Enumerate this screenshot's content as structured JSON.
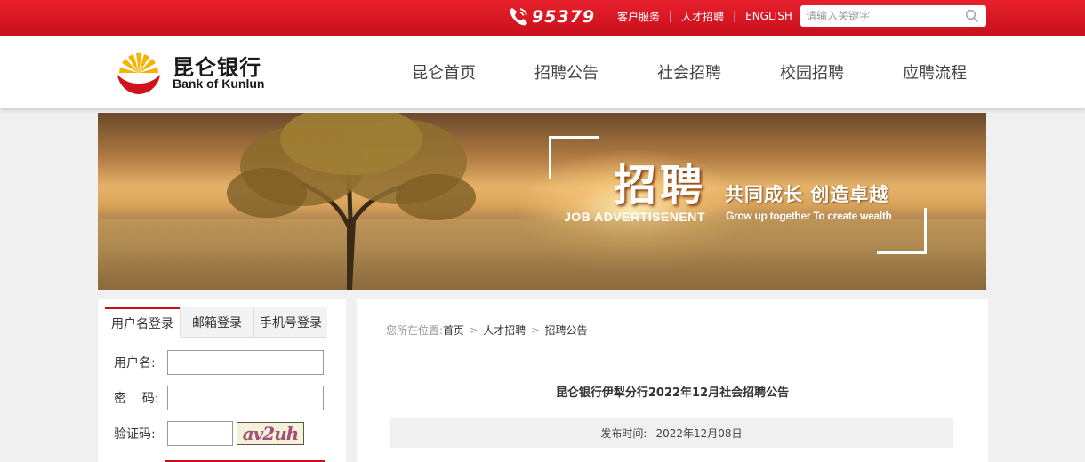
{
  "topbar": {
    "hotline": "95379",
    "links": [
      "客户服务",
      "人才招聘",
      "ENGLISH"
    ],
    "separator": "|",
    "search_placeholder": "请输入关键字",
    "bg_color": "#d8141f"
  },
  "header": {
    "logo_cn": "昆仑银行",
    "logo_en": "Bank of Kunlun",
    "nav": [
      "昆仑首页",
      "招聘公告",
      "社会招聘",
      "校园招聘",
      "应聘流程"
    ]
  },
  "banner": {
    "title": "招聘",
    "slogan": "共同成长  创造卓越",
    "en_title": "JOB   ADVERTISENENT",
    "en_slogan": "Grow up together To create wealth"
  },
  "login": {
    "tabs": [
      "用户名登录",
      "邮箱登录",
      "手机号登录"
    ],
    "active_tab": "用户名登录",
    "username_label": "用户名:",
    "password_label": "密    码:",
    "captcha_label": "验证码:",
    "captcha_text": "av2uh",
    "accent_color": "#c8101c"
  },
  "content": {
    "breadcrumb_prefix": "您所在位置:",
    "breadcrumb": [
      "首页",
      "人才招聘",
      "招聘公告"
    ],
    "breadcrumb_arrow": ">",
    "article_title": "昆仑银行伊犁分行2022年12月社会招聘公告",
    "publish_label": "发布时间:",
    "publish_date": "2022年12月08日"
  }
}
